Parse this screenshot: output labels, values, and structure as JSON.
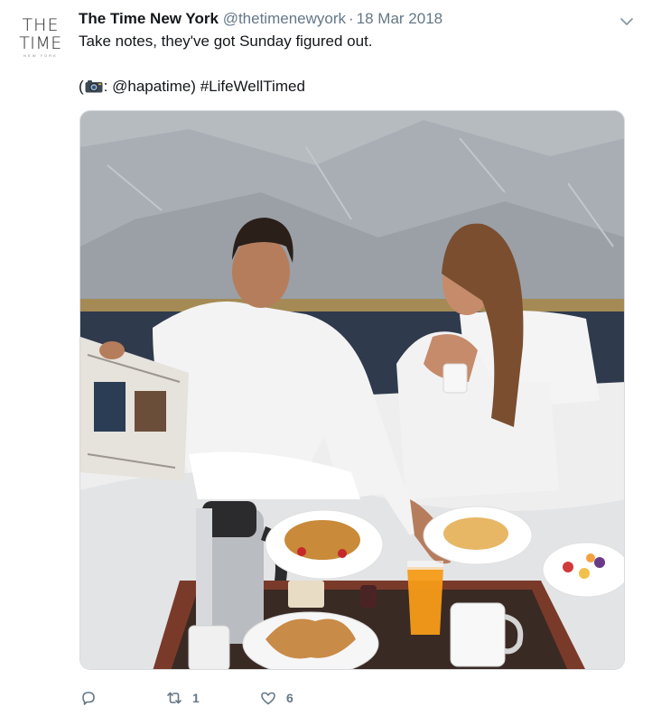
{
  "account": {
    "avatar_lines": [
      "THE",
      "TIME",
      "NEW YORK"
    ],
    "name": "The Time New York",
    "handle": "@thetimenewyork",
    "separator": "·",
    "date": "18 Mar 2018"
  },
  "tweet": {
    "line1": "Take notes, they've got Sunday figured out.",
    "line2_prefix": "(",
    "line2_suffix": ": @hapatime) #LifeWellTimed"
  },
  "icons": {
    "menu": "chevron-down-icon",
    "camera": "camera-emoji-icon",
    "reply": "reply-icon",
    "retweet": "retweet-icon",
    "like": "heart-icon"
  },
  "actions": {
    "reply_count": "",
    "retweet_count": "1",
    "like_count": "6"
  },
  "colors": {
    "name": "#14171a",
    "secondary": "#657786",
    "border": "#d7dbdf"
  }
}
